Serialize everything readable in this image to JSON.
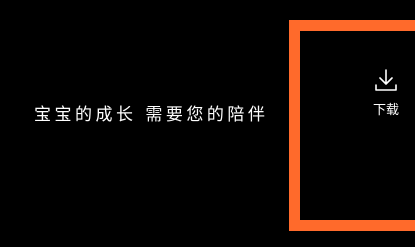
{
  "splash": {
    "slogan": "宝宝的成长 需要您的陪伴"
  },
  "download": {
    "label": "下载",
    "icon": "download-icon"
  },
  "colors": {
    "background": "#000000",
    "text": "#ffffff",
    "highlight_frame": "#ff6a2b"
  }
}
